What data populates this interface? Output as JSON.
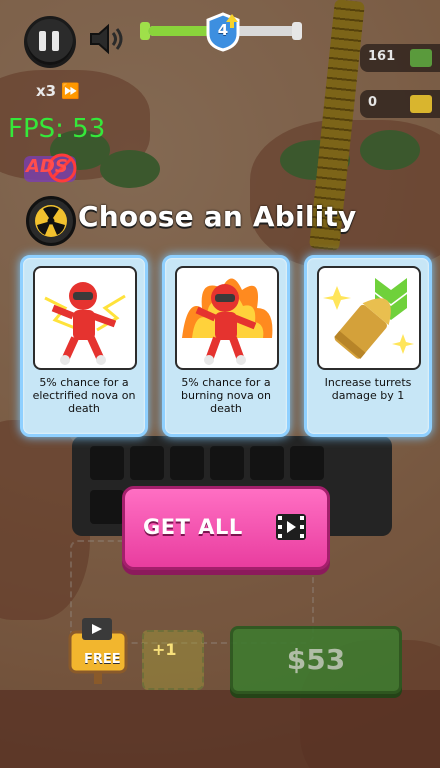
{
  "hud": {
    "level": "4",
    "level_progress": 0.45,
    "speed_label": "x3",
    "currency_a": "161",
    "currency_b": "0",
    "fps": "FPS: 53",
    "ads_label": "ADS"
  },
  "modal": {
    "title": "Choose an Ability",
    "cards": [
      {
        "text": "5% chance for a electrified nova on death",
        "icon": "electrified-character-icon"
      },
      {
        "text": "5% chance for a burning nova on death",
        "icon": "burning-character-icon"
      },
      {
        "text": "Increase turrets damage by 1",
        "icon": "bullet-upgrade-icon"
      }
    ],
    "get_all_label": "GET ALL",
    "get_all_icon": "video-ad-icon"
  },
  "bottom": {
    "free_label": "FREE",
    "plus_label": "+1",
    "buy_label": "$53"
  },
  "colors": {
    "fps": "#35e83a",
    "get_all": "#f04ea8",
    "card_glow": "#8fd0ff",
    "progress_fill": "#8ad43b"
  }
}
